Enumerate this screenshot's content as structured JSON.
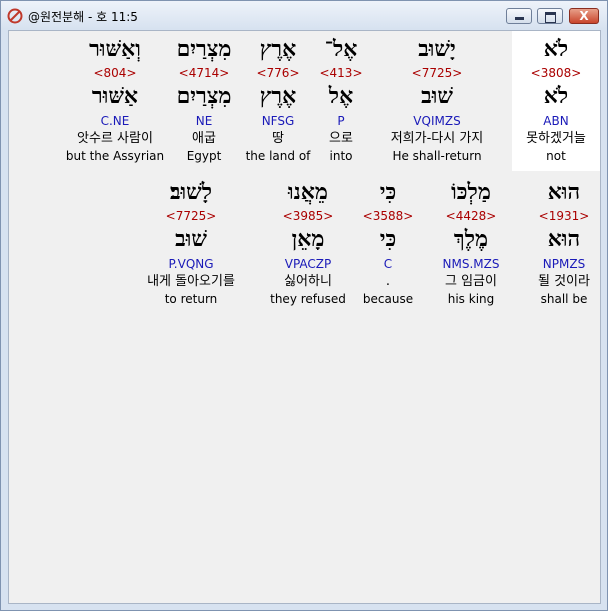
{
  "window": {
    "title": "@원전분해 - 호 11:5",
    "buttons": {
      "minimize": "",
      "maximize": "",
      "close": "X"
    },
    "accent_close": "#c9452c"
  },
  "verse": {
    "rows": [
      {
        "words": [
          {
            "hebrew": "לֹא",
            "strong": "<3808>",
            "lexeme": "לֹא",
            "parse": "ABN",
            "korean": "못하겠거늘",
            "english": "not",
            "selected": true
          },
          {
            "hebrew": "יָשׁוּב",
            "strong": "<7725>",
            "lexeme": "שׁוּב",
            "parse": "VQIMZS",
            "korean": "저희가-다시 가지",
            "english": "He shall-return",
            "selected": false
          },
          {
            "hebrew": "אֶל־",
            "strong": "<413>",
            "lexeme": "אֶל",
            "parse": "P",
            "korean": "으로",
            "english": "into",
            "selected": false
          },
          {
            "hebrew": "אֶרֶץ",
            "strong": "<776>",
            "lexeme": "אֶרֶץ",
            "parse": "NFSG",
            "korean": "땅",
            "english": "the land of",
            "selected": false
          },
          {
            "hebrew": "מִצְרַיִם",
            "strong": "<4714>",
            "lexeme": "מִצְרַיִם",
            "parse": "NE",
            "korean": "애굽",
            "english": "Egypt",
            "selected": false
          },
          {
            "hebrew": "וְאַשּׁוּר",
            "strong": "<804>",
            "lexeme": "אַשּׁוּר",
            "parse": "C.NE",
            "korean": "앗수르 사람이",
            "english": "but the Assyrian",
            "selected": false
          }
        ]
      },
      {
        "words": [
          {
            "hebrew": "הוּא",
            "strong": "<1931>",
            "lexeme": "הוּא",
            "parse": "NPMZS",
            "korean": "될 것이라",
            "english": "shall be",
            "selected": false
          },
          {
            "hebrew": "מַלְכּוֹ",
            "strong": "<4428>",
            "lexeme": "מֶלֶךְ",
            "parse": "NMS.MZS",
            "korean": "그 임금이",
            "english": "his king",
            "selected": false
          },
          {
            "hebrew": "כִּי",
            "strong": "<3588>",
            "lexeme": "כִּי",
            "parse": "C",
            "korean": ".",
            "english": "because",
            "selected": false
          },
          {
            "hebrew": "מֵאֲנוּ",
            "strong": "<3985>",
            "lexeme": "מָאֵן",
            "parse": "VPACZP",
            "korean": "싫어하니",
            "english": "they refused",
            "selected": false
          },
          {
            "hebrew": "לָשׁוּב׃",
            "strong": "<7725>",
            "lexeme": "שׁוּב",
            "parse": "P.VQNG",
            "korean": "내게 돌아오기를",
            "english": "to return",
            "selected": false
          }
        ]
      }
    ]
  },
  "colors": {
    "strong": "#aa0000",
    "parse": "#1a1ab8",
    "selected_background": "#ffffff"
  }
}
